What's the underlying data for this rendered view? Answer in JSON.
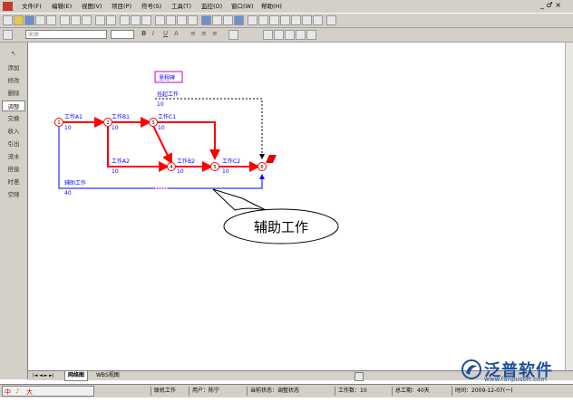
{
  "menu": {
    "items": [
      "文件(F)",
      "编辑(E)",
      "视图(V)",
      "项目(P)",
      "符号(S)",
      "工具(T)",
      "监控(O)",
      "窗口(W)",
      "帮助(H)"
    ],
    "window_controls": "_ ♂ ×"
  },
  "toolbar2": {
    "font_placeholder": "宋体",
    "format_buttons": [
      "B",
      "I",
      "U",
      "A",
      "≡",
      "≡",
      "≡"
    ]
  },
  "left_panel": {
    "items": [
      "添加",
      "修改",
      "删除",
      "调整",
      "交换",
      "收入",
      "引出",
      "流水",
      "搭接",
      "时差",
      "空隙"
    ],
    "active_index": 3
  },
  "network": {
    "milestone_label": "里程碑",
    "tasks": {
      "a1": {
        "name": "工作A1",
        "duration": "10"
      },
      "b1": {
        "name": "工作B1",
        "duration": "10"
      },
      "c1": {
        "name": "工作C1",
        "duration": "10"
      },
      "a2": {
        "name": "工作A2",
        "duration": "10"
      },
      "b2": {
        "name": "工作B2",
        "duration": "10"
      },
      "c2": {
        "name": "工作C2",
        "duration": "10"
      },
      "dummy_top": {
        "name": "挂起工作",
        "duration": "10"
      },
      "aux": {
        "name": "辅助工作",
        "duration": "40"
      }
    },
    "nodes": [
      "1",
      "2",
      "3",
      "4",
      "5",
      "6"
    ]
  },
  "callout": {
    "text": "辅助工作"
  },
  "tabs": [
    "网络图",
    "WBS视图"
  ],
  "tab_nav": "|◄ ◄ ► ►|",
  "status": {
    "mode": "联机工作",
    "user": "用户：陈宁",
    "state": "当前状态：调整状态",
    "task_count": "工作数：10",
    "duration": "总工期：40天",
    "date": "时间：2009-12-07(一)"
  },
  "taskbar": {
    "ime": "中",
    "items": [
      "中",
      "♪",
      "大"
    ]
  },
  "logo": {
    "brand": "泛普软件",
    "url": "www.fanpusoft.com"
  },
  "colors": {
    "critical": "#ff0000",
    "normal": "#0000ff",
    "dummy": "#000000",
    "brand": "#1e4f9c"
  }
}
